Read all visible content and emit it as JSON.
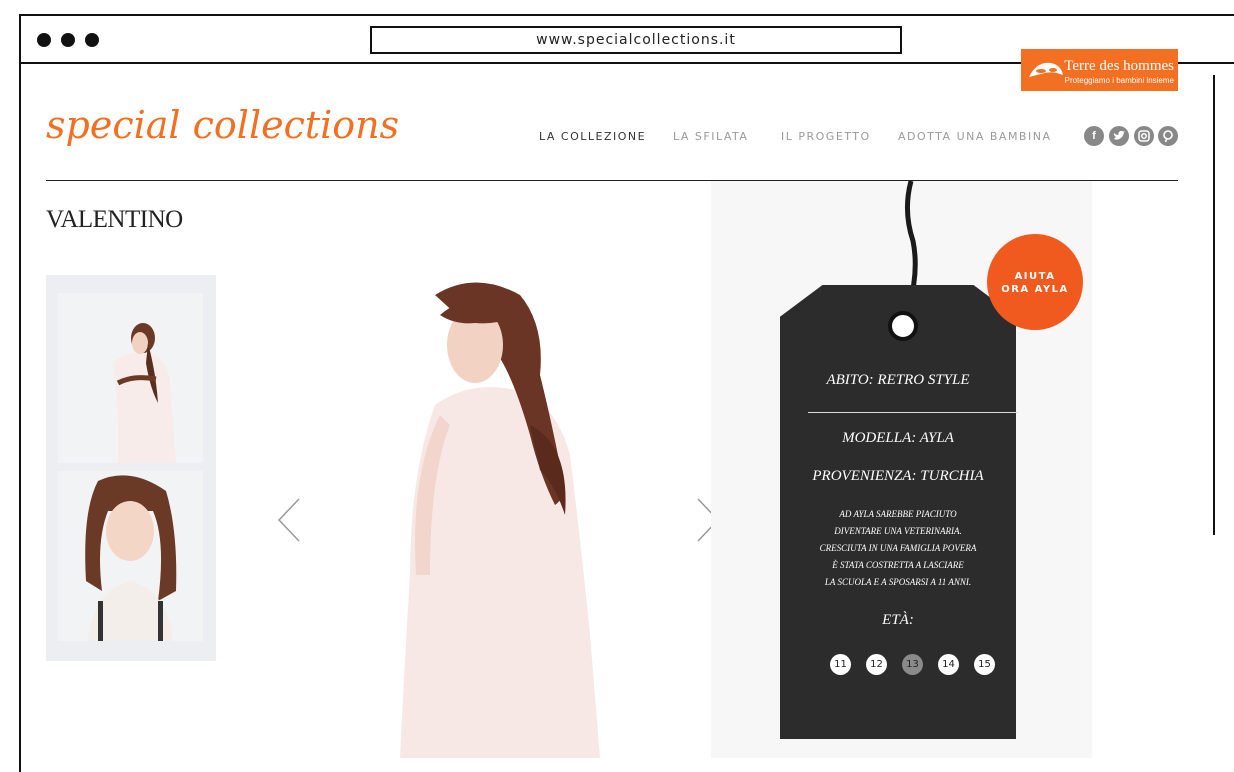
{
  "browser": {
    "url": "www.specialcollections.it"
  },
  "partner": {
    "name": "Terre des hommes",
    "tagline": "Proteggiamo i bambini insieme"
  },
  "site": {
    "logo": "special collections"
  },
  "nav": [
    {
      "label": "LA COLLEZIONE"
    },
    {
      "label": "LA SFILATA"
    },
    {
      "label": "IL PROGETTO"
    },
    {
      "label": "ADOTTA UNA BAMBINA"
    }
  ],
  "social": [
    "facebook-icon",
    "twitter-icon",
    "instagram-icon",
    "pinterest-icon"
  ],
  "main": {
    "brand": "VALENTINO"
  },
  "tag": {
    "cta_line1": "AIUTA",
    "cta_line2": "ORA AYLA",
    "abito": "ABITO: RETRO STYLE",
    "modella": "MODELLA: AYLA",
    "provenienza": "PROVENIENZA: TURCHIA",
    "story": [
      "AD AYLA SAREBBE PIACIUTO",
      "DIVENTARE UNA VETERINARIA.",
      "CRESCIUTA IN UNA FAMIGLIA POVERA",
      "È STATA COSTRETTA A LASCIARE",
      "LA SCUOLA E A SPOSARSI A 11 ANNI."
    ],
    "eta_label": "ETÀ:",
    "ages": [
      "11",
      "12",
      "13",
      "14",
      "15"
    ],
    "selected_age": "13"
  },
  "colors": {
    "accent": "#f36f21",
    "tag": "#2c2c2c"
  }
}
